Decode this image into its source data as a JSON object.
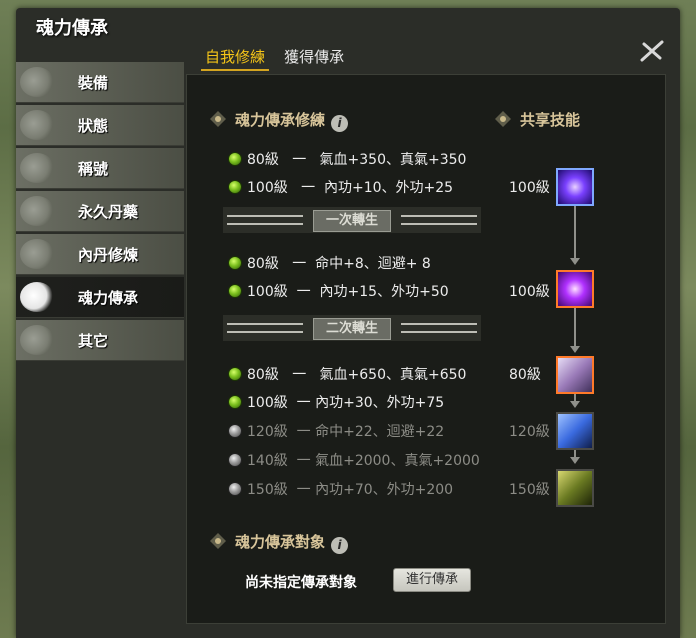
{
  "window": {
    "title": "魂力傳承"
  },
  "sidebar": {
    "items": [
      {
        "label": "裝備"
      },
      {
        "label": "狀態"
      },
      {
        "label": "稱號"
      },
      {
        "label": "永久丹藥"
      },
      {
        "label": "內丹修煉"
      },
      {
        "label": "魂力傳承"
      },
      {
        "label": "其它"
      }
    ],
    "active": "魂力傳承"
  },
  "tabs": [
    {
      "label": "自我修練"
    },
    {
      "label": "獲得傳承"
    }
  ],
  "sections": {
    "training_title": "魂力傳承修練",
    "shared_skills_title": "共享技能",
    "target_title": "魂力傳承對象"
  },
  "rows": [
    {
      "level": "80級",
      "dash": "一",
      "effect": "氣血+350、真氣+350",
      "state": "active"
    },
    {
      "level": "100級",
      "dash": "一",
      "effect": "內功+10、外功+25",
      "state": "active"
    },
    {
      "level": "80級",
      "dash": "一",
      "effect": "命中+8、迴避+ 8",
      "state": "active"
    },
    {
      "level": "100級",
      "dash": "一",
      "effect": "內功+15、外功+50",
      "state": "active"
    },
    {
      "level": "80級",
      "dash": "一",
      "effect": "氣血+650、真氣+650",
      "state": "active"
    },
    {
      "level": "100級",
      "dash": "一",
      "effect": "內功+30、外功+75",
      "state": "active"
    },
    {
      "level": "120級",
      "dash": "一",
      "effect": "命中+22、迴避+22",
      "state": "locked"
    },
    {
      "level": "140級",
      "dash": "一",
      "effect": "氣血+2000、真氣+2000",
      "state": "locked"
    },
    {
      "level": "150級",
      "dash": "一",
      "effect": "內功+70、外功+200",
      "state": "locked"
    }
  ],
  "rebirths": [
    {
      "label": "一次轉生"
    },
    {
      "label": "二次轉生"
    }
  ],
  "skills": [
    {
      "level": "100級",
      "icon": "purple-vortex-skill-icon",
      "color": "#6a3cff"
    },
    {
      "level": "100級",
      "icon": "violet-swirl-skill-icon",
      "color": "#a020f0"
    },
    {
      "level": "80級",
      "icon": "warrior-strike-skill-icon",
      "color": "#c8b4e6"
    },
    {
      "level": "120級",
      "icon": "winged-figure-skill-icon",
      "color": "#3a7adf"
    },
    {
      "level": "150級",
      "icon": "golden-figure-skill-icon",
      "color": "#6a7a22"
    }
  ],
  "target": {
    "status_text": "尚未指定傳承對象",
    "button_label": "進行傳承"
  },
  "colors": {
    "active_tab": "#f5c518",
    "section_heading": "#d8c59a",
    "locked_text": "#8c8c86"
  }
}
